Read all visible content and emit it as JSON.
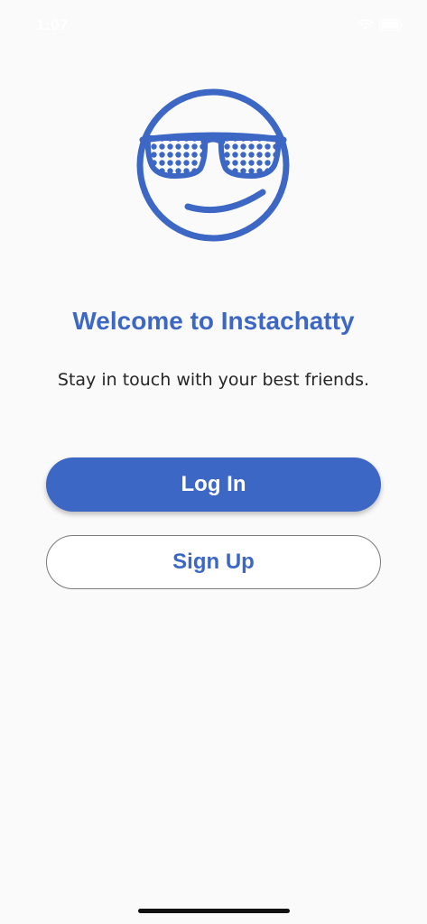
{
  "status_bar": {
    "time": "1:07"
  },
  "logo": {
    "icon": "sunglasses-smiley-icon",
    "color": "#3d67c5"
  },
  "welcome": {
    "title": "Welcome to Instachatty",
    "subtitle": "Stay in touch with your best friends."
  },
  "actions": {
    "login_label": "Log In",
    "signup_label": "Sign Up"
  },
  "colors": {
    "brand": "#3d67c5",
    "background": "#fafafa",
    "text": "#262626"
  }
}
